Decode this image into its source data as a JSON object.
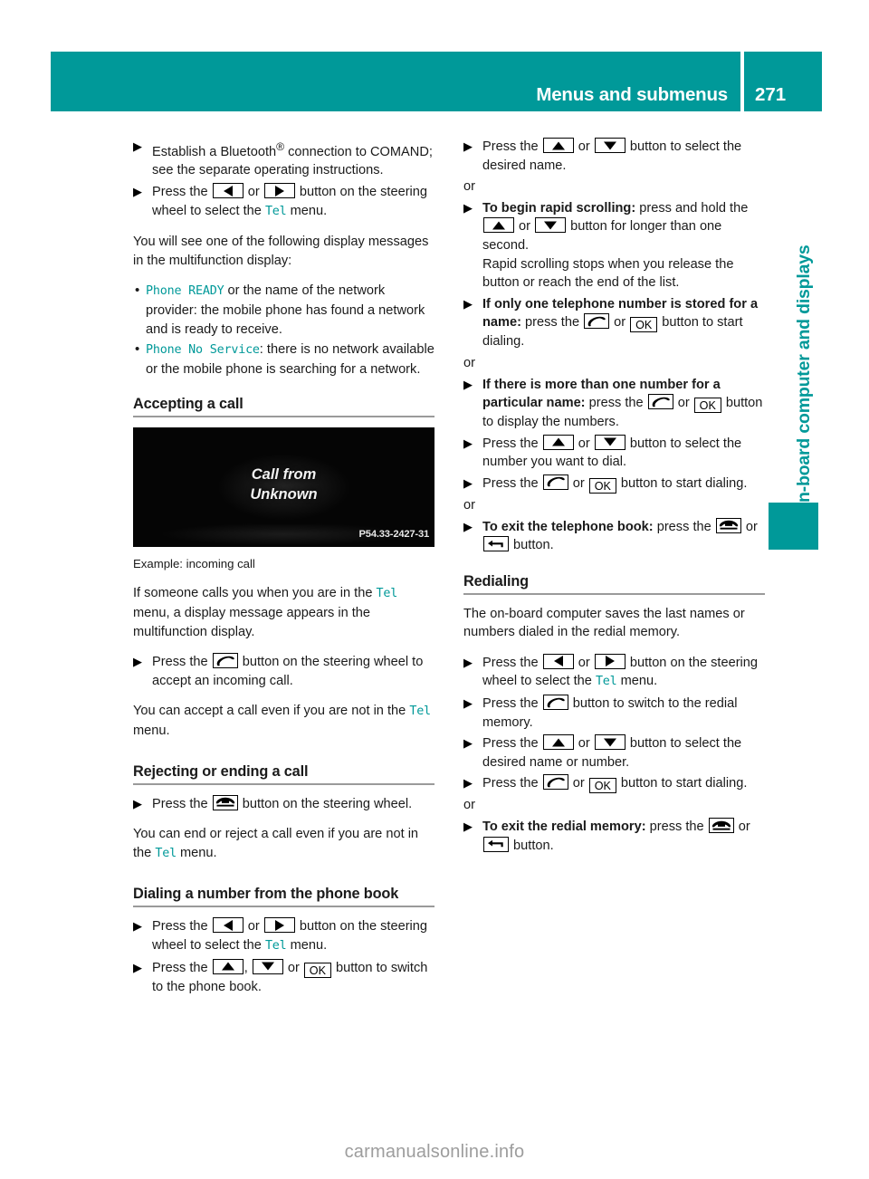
{
  "header": {
    "title": "Menus and submenus",
    "page_number": "271",
    "accent_color": "#009999"
  },
  "side_tab": {
    "label": "On-board computer and displays",
    "color": "#009999"
  },
  "figure": {
    "line1": "Call from",
    "line2": "Unknown",
    "code": "P54.33-2427-31",
    "caption": "Example: incoming call"
  },
  "left_column": {
    "step_bluetooth": {
      "t1": "Establish a Bluetooth",
      "sup": "®",
      "t2": " connection to COMAND; see the separate operating instructions."
    },
    "step_select_tel": {
      "t1": "Press the ",
      "or": " or ",
      "t2": " button on the steering wheel to select the ",
      "menu": "Tel",
      "t3": " menu."
    },
    "para_messages": "You will see one of the following display messages in the multifunction display:",
    "bullet_ready": {
      "code": "Phone READY",
      "text": " or the name of the network provider: the mobile phone has found a network and is ready to receive."
    },
    "bullet_noservice": {
      "code": "Phone No Service",
      "text": ": there is no network available or the mobile phone is searching for a network."
    },
    "heading_accepting": "Accepting a call",
    "para_if_someone": {
      "t1": "If someone calls you when you are in the ",
      "menu": "Tel",
      "t2": " menu, a display message appears in the multifunction display."
    },
    "step_accept": {
      "t1": "Press the ",
      "t2": " button on the steering wheel to accept an incoming call."
    },
    "para_accept_even": {
      "t1": "You can accept a call even if you are not in the ",
      "menu": "Tel",
      "t2": " menu."
    },
    "heading_rejecting": "Rejecting or ending a call",
    "step_reject": {
      "t1": "Press the ",
      "t2": " button on the steering wheel."
    },
    "para_end_even": {
      "t1": "You can end or reject a call even if you are not in the ",
      "menu": "Tel",
      "t2": " menu."
    },
    "heading_dialing": "Dialing a number from the phone book",
    "step_dial_select": {
      "t1": "Press the ",
      "or": " or ",
      "t2": " button on the steering wheel to select the ",
      "menu": "Tel",
      "t3": " menu."
    },
    "step_dial_switch": {
      "t1": "Press the ",
      "comma": ", ",
      "or": " or ",
      "t2": " button to switch to the phone book."
    }
  },
  "right_column": {
    "step_select_name": {
      "t1": "Press the ",
      "or": " or ",
      "t2": " button to select the desired name."
    },
    "or_1": "or",
    "step_rapid_scroll": {
      "bold": "To begin rapid scrolling:",
      "t1": " press and hold the ",
      "or": " or ",
      "t2": " button for longer than one second.",
      "t3": "Rapid scrolling stops when you release the button or reach the end of the list."
    },
    "step_one_number": {
      "bold": "If only one telephone number is stored for a name:",
      "t1": " press the ",
      "or": " or ",
      "t2": " button to start dialing."
    },
    "or_2": "or",
    "step_more_numbers": {
      "bold": "If there is more than one number for a particular name:",
      "t1": " press the ",
      "or": " or ",
      "t2": " button to display the numbers."
    },
    "step_select_number": {
      "t1": "Press the ",
      "or": " or ",
      "t2": " button to select the number you want to dial."
    },
    "step_start_dialing": {
      "t1": "Press the ",
      "or": " or ",
      "t2": " button to start dialing."
    },
    "or_3": "or",
    "step_exit_book": {
      "bold": "To exit the telephone book:",
      "t1": " press the ",
      "or": " or ",
      "t2": " button."
    },
    "heading_redialing": "Redialing",
    "para_redial": "The on-board computer saves the last names or numbers dialed in the redial memory.",
    "step_redial_select": {
      "t1": "Press the ",
      "or": " or ",
      "t2": " button on the steering wheel to select the ",
      "menu": "Tel",
      "t3": " menu."
    },
    "step_redial_switch": {
      "t1": "Press the ",
      "t2": " button to switch to the redial memory."
    },
    "step_redial_name": {
      "t1": "Press the ",
      "or": " or ",
      "t2": " button to select the desired name or number."
    },
    "step_redial_dial": {
      "t1": "Press the ",
      "or": " or ",
      "t2": " button to start dialing."
    },
    "or_4": "or",
    "step_exit_redial": {
      "bold": "To exit the redial memory:",
      "t1": " press the ",
      "or": " or ",
      "t2": " button."
    }
  },
  "keys": {
    "ok_label": "OK",
    "left_arrow": "left-arrow-key",
    "right_arrow": "right-arrow-key",
    "up_arrow": "up-arrow-key",
    "down_arrow": "down-arrow-key",
    "accept_call": "accept-call-key",
    "end_call": "end-call-key",
    "back": "back-key"
  },
  "marker": {
    "triangle": "▶",
    "dot": "•"
  },
  "watermark": "carmanualsonline.info"
}
